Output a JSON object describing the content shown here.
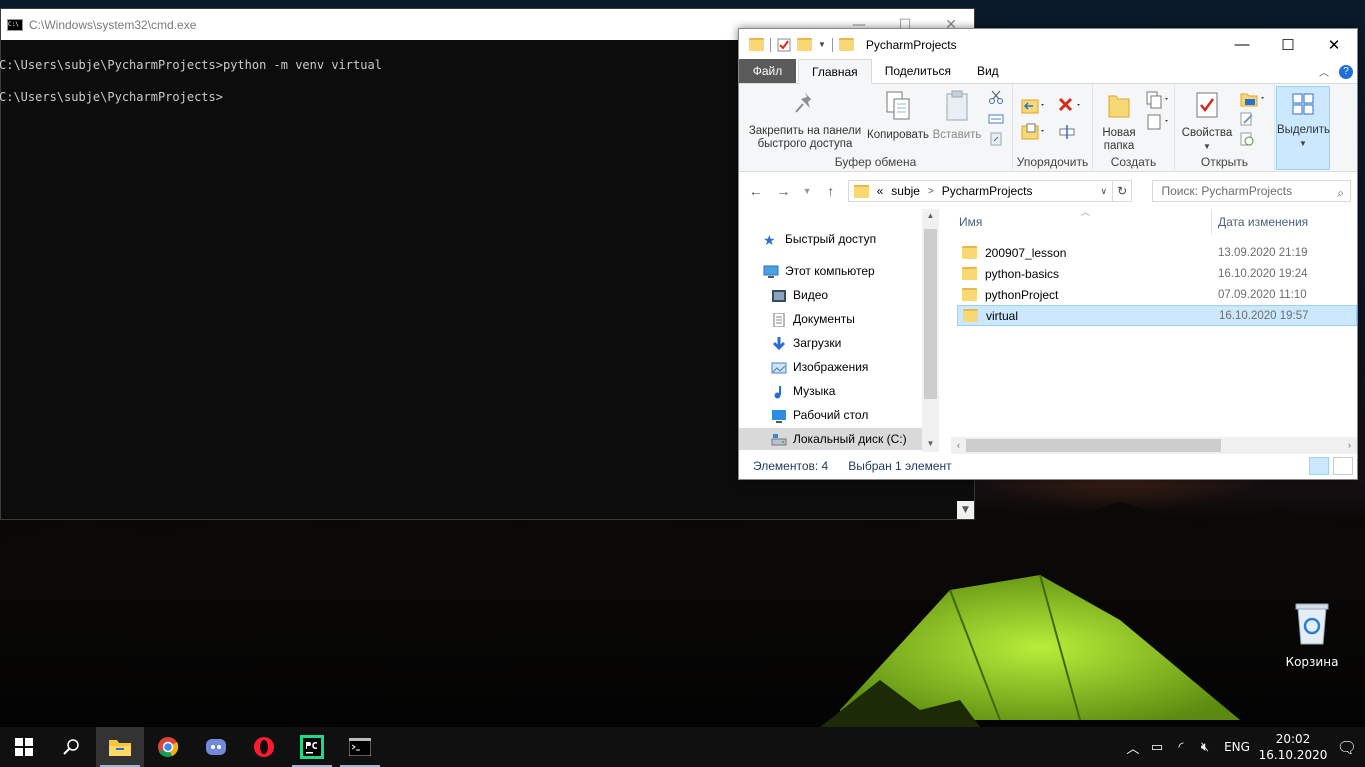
{
  "cmd": {
    "title": "C:\\Windows\\system32\\cmd.exe",
    "lines": [
      "C:\\Users\\subje\\PycharmProjects>python -m venv virtual",
      "C:\\Users\\subje\\PycharmProjects>"
    ],
    "minimize": "—",
    "maximize": "☐",
    "close": "✕"
  },
  "explorer": {
    "title": "PycharmProjects",
    "tabs": [
      "Файл",
      "Главная",
      "Поделиться",
      "Вид"
    ],
    "ribbon": {
      "pin": "Закрепить на панели быстрого доступа",
      "copy": "Копировать",
      "paste": "Вставить",
      "clipboard_group": "Буфер обмена",
      "organize_group": "Упорядочить",
      "new_folder": "Новая папка",
      "create_group": "Создать",
      "properties": "Свойства",
      "open_group": "Открыть",
      "select": "Выделить"
    },
    "address": {
      "prefix": "«",
      "crumbs": [
        "subje",
        "PycharmProjects"
      ]
    },
    "search_placeholder": "Поиск: PycharmProjects",
    "nav": [
      {
        "label": "Быстрый доступ",
        "icon": "star-icon"
      },
      {
        "label": "Этот компьютер",
        "icon": "computer-icon"
      },
      {
        "label": "Видео",
        "icon": "video-icon"
      },
      {
        "label": "Документы",
        "icon": "documents-icon"
      },
      {
        "label": "Загрузки",
        "icon": "download-icon"
      },
      {
        "label": "Изображения",
        "icon": "pictures-icon"
      },
      {
        "label": "Музыка",
        "icon": "music-icon"
      },
      {
        "label": "Рабочий стол",
        "icon": "desktop-icon"
      },
      {
        "label": "Локальный диск (C:)",
        "icon": "drive-icon"
      }
    ],
    "columns": {
      "name": "Имя",
      "date": "Дата изменения"
    },
    "files": [
      {
        "name": "200907_lesson",
        "date": "13.09.2020 21:19"
      },
      {
        "name": "python-basics",
        "date": "16.10.2020 19:24"
      },
      {
        "name": "pythonProject",
        "date": "07.09.2020 11:10"
      },
      {
        "name": "virtual",
        "date": "16.10.2020 19:57"
      }
    ],
    "status": {
      "count": "Элементов: 4",
      "selected": "Выбран 1 элемент"
    }
  },
  "desktop": {
    "recycle_bin": "Корзина"
  },
  "taskbar": {
    "apps": [
      "start-icon",
      "search-icon",
      "file-explorer-icon",
      "chrome-icon",
      "discord-icon",
      "opera-icon",
      "pycharm-icon",
      "cmd-icon"
    ],
    "lang": "ENG",
    "time": "20:02",
    "date": "16.10.2020"
  }
}
